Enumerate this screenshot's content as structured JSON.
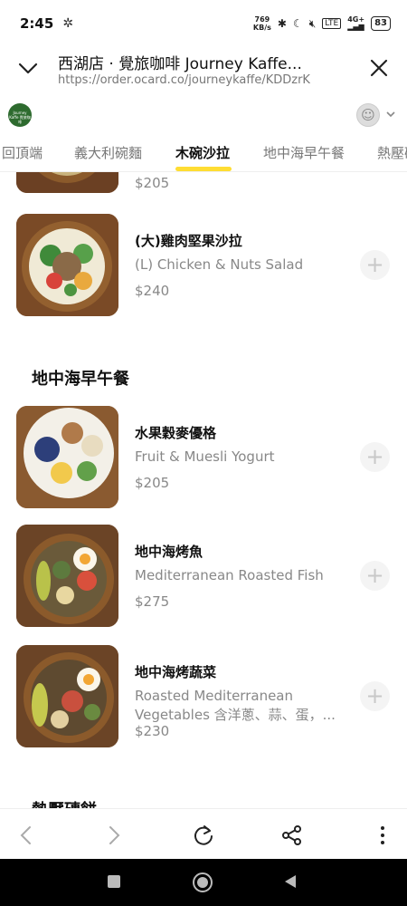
{
  "status_bar": {
    "time": "2:45",
    "net_speed_value": "769",
    "net_speed_unit": "KB/s",
    "network": "4G+",
    "battery": "83"
  },
  "browser": {
    "title": "西湖店 · 覺旅咖啡 Journey Kaffe...",
    "url": "https://order.ocard.co/journeykaffe/KDDzrK"
  },
  "store": {
    "logo_text": "Journey Kaffe 覺旅咖啡"
  },
  "tabs": [
    {
      "label": "回頂端",
      "active": false
    },
    {
      "label": "義大利碗麵",
      "active": false
    },
    {
      "label": "木碗沙拉",
      "active": true
    },
    {
      "label": "地中海早午餐",
      "active": false
    },
    {
      "label": "熱壓磚",
      "active": false
    }
  ],
  "menu": {
    "partial_item_price": "$205",
    "items": [
      {
        "name": "(大)雞肉堅果沙拉",
        "desc": "(L) Chicken & Nuts Salad",
        "price": "$240",
        "add_icon": "plus-icon"
      },
      {
        "name": "水果穀麥優格",
        "desc": "Fruit & Muesli Yogurt",
        "price": "$205",
        "add_icon": "plus-icon"
      },
      {
        "name": "地中海烤魚",
        "desc": "Mediterranean Roasted Fish",
        "price": "$275",
        "add_icon": "plus-icon"
      },
      {
        "name": "地中海烤蔬菜",
        "desc": "Roasted Mediterranean Vegetables 含洋蔥、蒜、蛋，...",
        "price": "$230",
        "add_icon": "plus-icon"
      }
    ],
    "section_mediterranean": "地中海早午餐",
    "section_next": "熱壓磚餅"
  },
  "colors": {
    "accent": "#ffdd33",
    "price": "#888888",
    "add_button_bg": "#f4f4f4"
  }
}
